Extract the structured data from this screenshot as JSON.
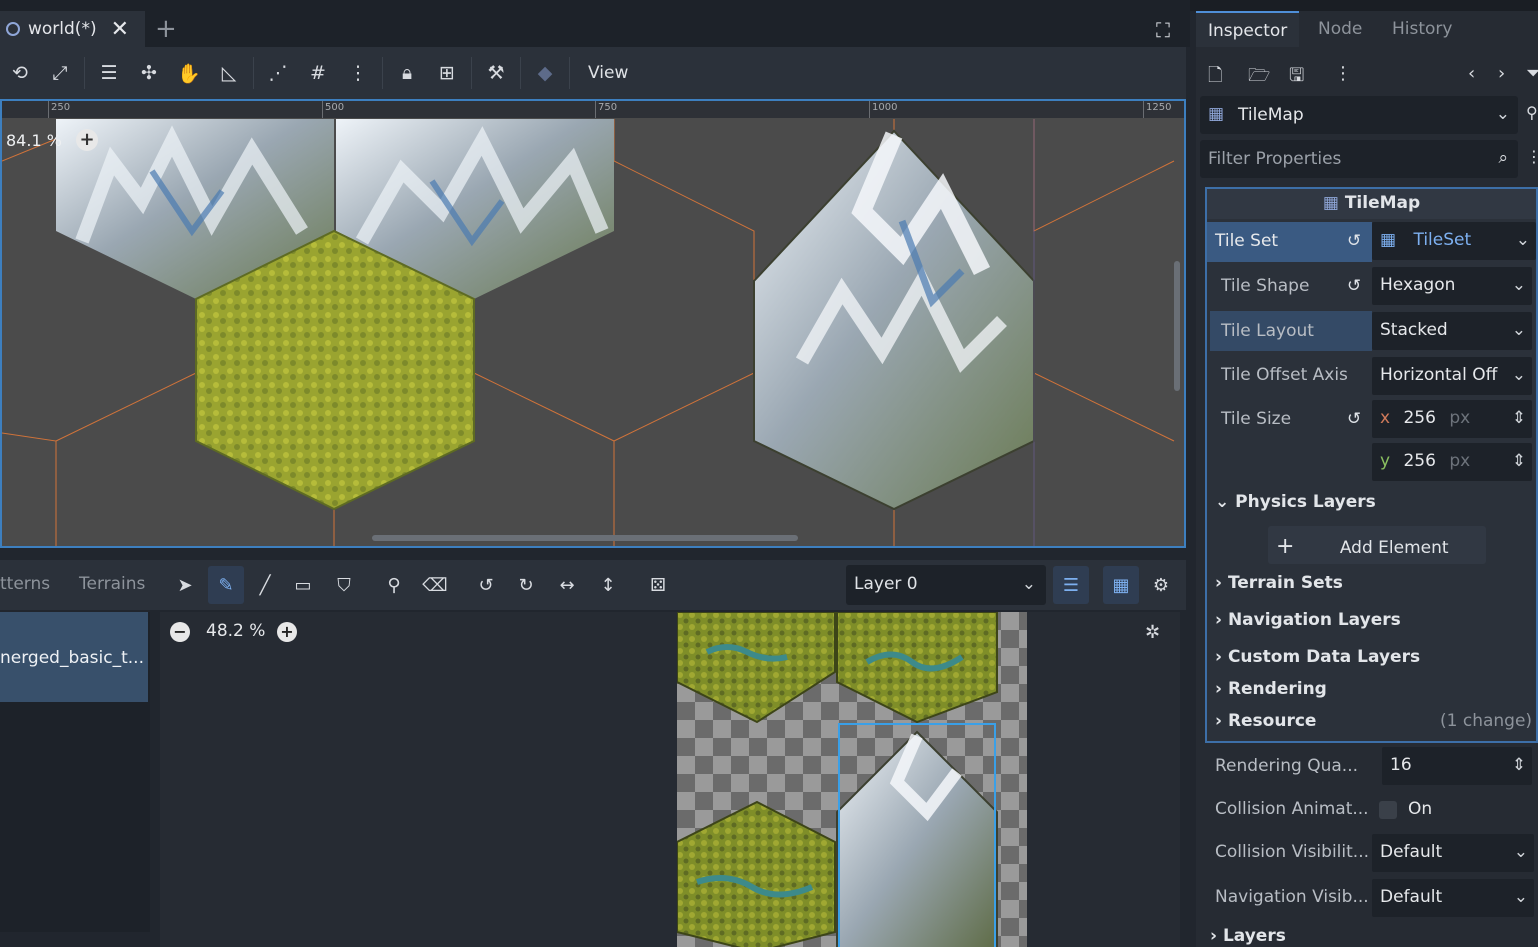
{
  "scene_tab": {
    "title": "world(*)"
  },
  "toolbar": {
    "view_label": "View"
  },
  "ruler": {
    "labels": [
      "250",
      "500",
      "750",
      "1000",
      "1250"
    ]
  },
  "viewport": {
    "zoom": "84.1 %"
  },
  "bottom_panel": {
    "tab_patterns": "tterns",
    "tab_terrains": "Terrains",
    "layer_select": "Layer 0",
    "source_item": "nerged_basic_t...",
    "atlas_zoom": "48.2 %"
  },
  "inspector": {
    "tabs": [
      "Inspector",
      "Node",
      "History"
    ],
    "node_type": "TileMap",
    "filter_placeholder": "Filter Properties",
    "section_title": "TileMap",
    "props": {
      "tile_set": {
        "label": "Tile Set",
        "value": "TileSet"
      },
      "tile_shape": {
        "label": "Tile Shape",
        "value": "Hexagon"
      },
      "tile_layout": {
        "label": "Tile Layout",
        "value": "Stacked"
      },
      "tile_offset_axis": {
        "label": "Tile Offset Axis",
        "value": "Horizontal Off"
      },
      "tile_size": {
        "label": "Tile Size",
        "x": "256",
        "y": "256",
        "unit": "px",
        "x_axis": "x",
        "y_axis": "y"
      }
    },
    "sections": {
      "physics_layers": "Physics Layers",
      "add_element": "Add Element",
      "terrain_sets": "Terrain Sets",
      "navigation_layers": "Navigation Layers",
      "custom_data_layers": "Custom Data Layers",
      "rendering": "Rendering",
      "resource": "Resource",
      "resource_changes": "(1 change)"
    },
    "node_props": {
      "rendering_quadrant": {
        "label": "Rendering Qua...",
        "value": "16"
      },
      "collision_animatable": {
        "label": "Collision Animat...",
        "value": "On"
      },
      "collision_visibility": {
        "label": "Collision Visibilit...",
        "value": "Default"
      },
      "navigation_visibility": {
        "label": "Navigation Visib...",
        "value": "Default"
      },
      "layers": "Layers"
    }
  },
  "colors": {
    "accent": "#4f8fd8",
    "hex_grid": "#d0733a",
    "snow": "#eef3f8",
    "rock": "#8c8f92",
    "grass": "#9aa430",
    "grass_dark": "#5e6b23",
    "water": "#3d8a8a"
  }
}
